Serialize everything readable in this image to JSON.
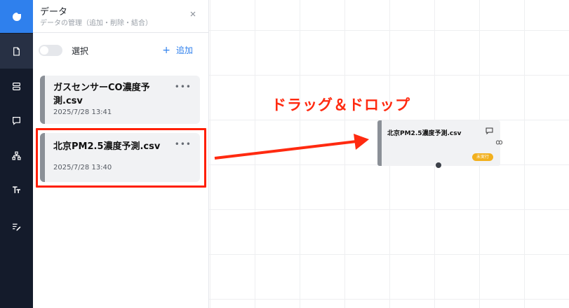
{
  "panel": {
    "title": "データ",
    "subtitle": "データの管理（追加・削除・結合）"
  },
  "controls": {
    "select_label": "選択",
    "add_label": "追加"
  },
  "files": [
    {
      "name": "ガスセンサーCO濃度予測.csv",
      "date": "2025/7/28 13:41"
    },
    {
      "name": "北京PM2.5濃度予測.csv",
      "date": "2025/7/28 13:40"
    }
  ],
  "annotation": {
    "text": "ドラッグ＆ドロップ",
    "color": "#ff2a10"
  },
  "node": {
    "title": "北京PM2.5濃度予測.csv",
    "status": "未実行"
  },
  "icons": {
    "logo": "app-logo-icon",
    "rail": [
      "document-icon",
      "database-icon",
      "chat-icon",
      "network-icon",
      "text-icon",
      "edit-list-icon"
    ]
  },
  "colors": {
    "accent": "#2f80ed",
    "rail_bg": "#141b2b",
    "highlight": "#ff1e00",
    "status_badge": "#f2b01e"
  }
}
